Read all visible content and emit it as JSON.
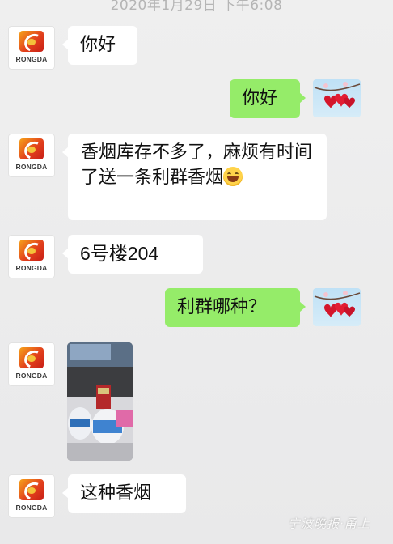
{
  "chat": {
    "timestamp": "2020年1月29日 下午6:08",
    "contact_avatar_brand": "RONGDA",
    "messages": [
      {
        "side": "left",
        "text": "你好"
      },
      {
        "side": "right",
        "text": "你好"
      },
      {
        "side": "left",
        "text": "香烟库存不多了，麻烦有时间了送一条利群香烟",
        "emoji": "grin"
      },
      {
        "side": "left",
        "text": "6号楼204"
      },
      {
        "side": "right",
        "text": "利群哪种？"
      },
      {
        "side": "left",
        "type": "image",
        "description_icon": "photo-of-cigarette-box"
      },
      {
        "side": "left",
        "text": "这种香烟"
      }
    ]
  },
  "watermark": "宁波晚报·甬上",
  "colors": {
    "my_bubble": "#95ec69",
    "their_bubble": "#ffffff",
    "background": "#ececec"
  }
}
